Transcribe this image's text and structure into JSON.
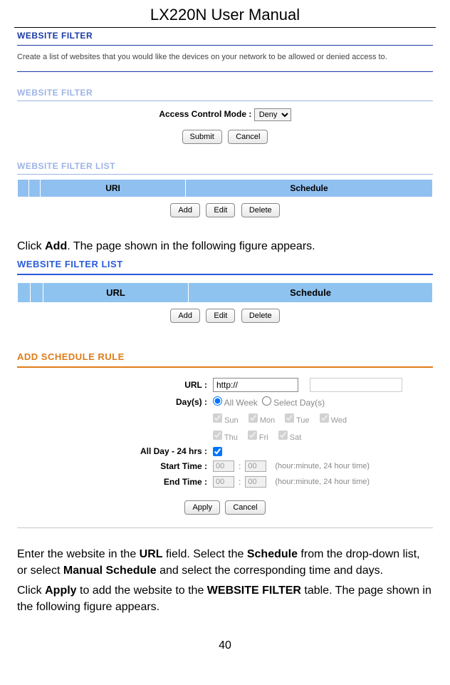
{
  "doc_title": "LX220N User Manual",
  "page_number": "40",
  "wf": {
    "title": "WEBSITE FILTER",
    "desc": "Create a list of websites that you would like the devices on your network to be allowed or denied access to.",
    "title2": "WEBSITE FILTER",
    "acm_label": "Access Control Mode :",
    "acm_value": "Deny",
    "submit": "Submit",
    "cancel": "Cancel",
    "list_title": "WEBSITE FILTER LIST",
    "col_uri": "URI",
    "col_sched": "Schedule",
    "add": "Add",
    "edit": "Edit",
    "delete": "Delete"
  },
  "body1_pre": "Click ",
  "body1_bold": "Add",
  "body1_post": ". The page shown in the following figure appears.",
  "wf2": {
    "list_title": "WEBSITE FILTER LIST",
    "col_url": "URL",
    "col_sched": "Schedule",
    "add": "Add",
    "edit": "Edit",
    "delete": "Delete"
  },
  "rule": {
    "title": "ADD SCHEDULE RULE",
    "url_label": "URL :",
    "url_value": "http://",
    "days_label": "Day(s) :",
    "days_all": "All Week",
    "days_sel": "Select Day(s)",
    "sun": "Sun",
    "mon": "Mon",
    "tue": "Tue",
    "wed": "Wed",
    "thu": "Thu",
    "fri": "Fri",
    "sat": "Sat",
    "allday_label": "All Day - 24 hrs :",
    "start_label": "Start Time :",
    "end_label": "End Time :",
    "h": "00",
    "m": "00",
    "hint": "(hour:minute, 24 hour time)",
    "apply": "Apply",
    "cancel": "Cancel"
  },
  "body2_a": "Enter the website in the ",
  "body2_url": "URL",
  "body2_b": " field. Select the ",
  "body2_sched": "Schedule",
  "body2_c": " from the drop-down list, or select ",
  "body2_ms": "Manual Schedule",
  "body2_d": " and select the corresponding time and days.",
  "body3_a": "Click ",
  "body3_apply": "Apply",
  "body3_b": " to add the website to the ",
  "body3_wf": "WEBSITE FILTER",
  "body3_c": " table. The page shown in the following figure appears."
}
